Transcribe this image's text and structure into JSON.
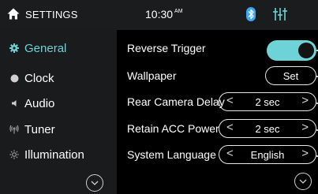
{
  "header": {
    "title": "SETTINGS",
    "time": "10:30",
    "ampm": "AM",
    "accent": "#6ed3d6",
    "bluetooth_color": "#3ea7f5",
    "eq_color": "#6ed3d6"
  },
  "sidebar": {
    "items": [
      {
        "label": "General",
        "icon": "gear-icon",
        "active": true
      },
      {
        "label": "Clock",
        "icon": "clock-dot-icon",
        "active": false
      },
      {
        "label": "Audio",
        "icon": "speaker-icon",
        "active": false
      },
      {
        "label": "Tuner",
        "icon": "antenna-icon",
        "active": false
      },
      {
        "label": "Illumination",
        "icon": "sun-icon",
        "active": false
      }
    ]
  },
  "settings": {
    "reverse_trigger": {
      "label": "Reverse Trigger",
      "enabled": true
    },
    "wallpaper": {
      "label": "Wallpaper",
      "button": "Set"
    },
    "rear_camera_delay": {
      "label": "Rear Camera Delay",
      "value": "2 sec"
    },
    "retain_acc_power": {
      "label": "Retain ACC Power",
      "value": "2 sec"
    },
    "system_language": {
      "label": "System Language",
      "value": "English"
    }
  },
  "arrows": {
    "left": "<",
    "right": ">"
  }
}
